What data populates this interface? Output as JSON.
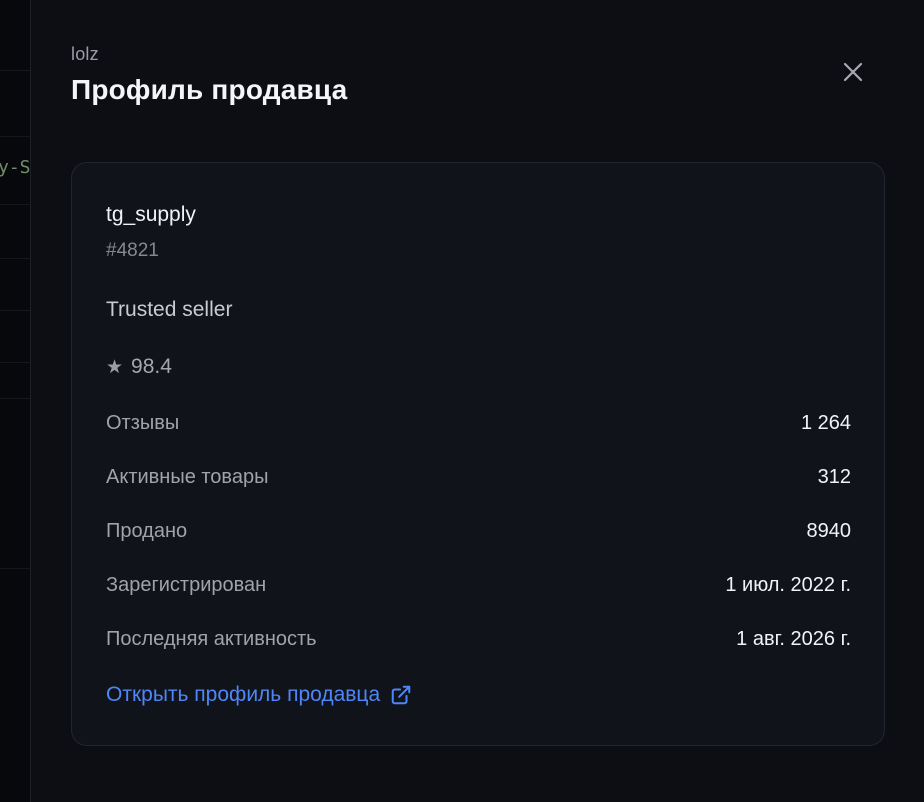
{
  "background": {
    "peek_text": "y-S"
  },
  "drawer": {
    "eyebrow": "lolz",
    "title": "Профиль продавца",
    "close_icon": "close-icon"
  },
  "seller": {
    "name": "tg_supply",
    "id": "#4821",
    "status": "Trusted seller",
    "rating_icon": "star-icon",
    "rating": "98.4"
  },
  "stats": [
    {
      "label": "Отзывы",
      "value": "1 264"
    },
    {
      "label": "Активные товары",
      "value": "312"
    },
    {
      "label": "Продано",
      "value": "8940"
    },
    {
      "label": "Зарегистрирован",
      "value": "1 июл. 2022 г."
    },
    {
      "label": "Последняя активность",
      "value": "1 авг. 2026 г."
    }
  ],
  "link": {
    "label": "Открыть профиль продавца",
    "icon": "external-link-icon"
  },
  "colors": {
    "background": "#0d0e14",
    "card": "#11131a",
    "link": "#4f86f7"
  }
}
